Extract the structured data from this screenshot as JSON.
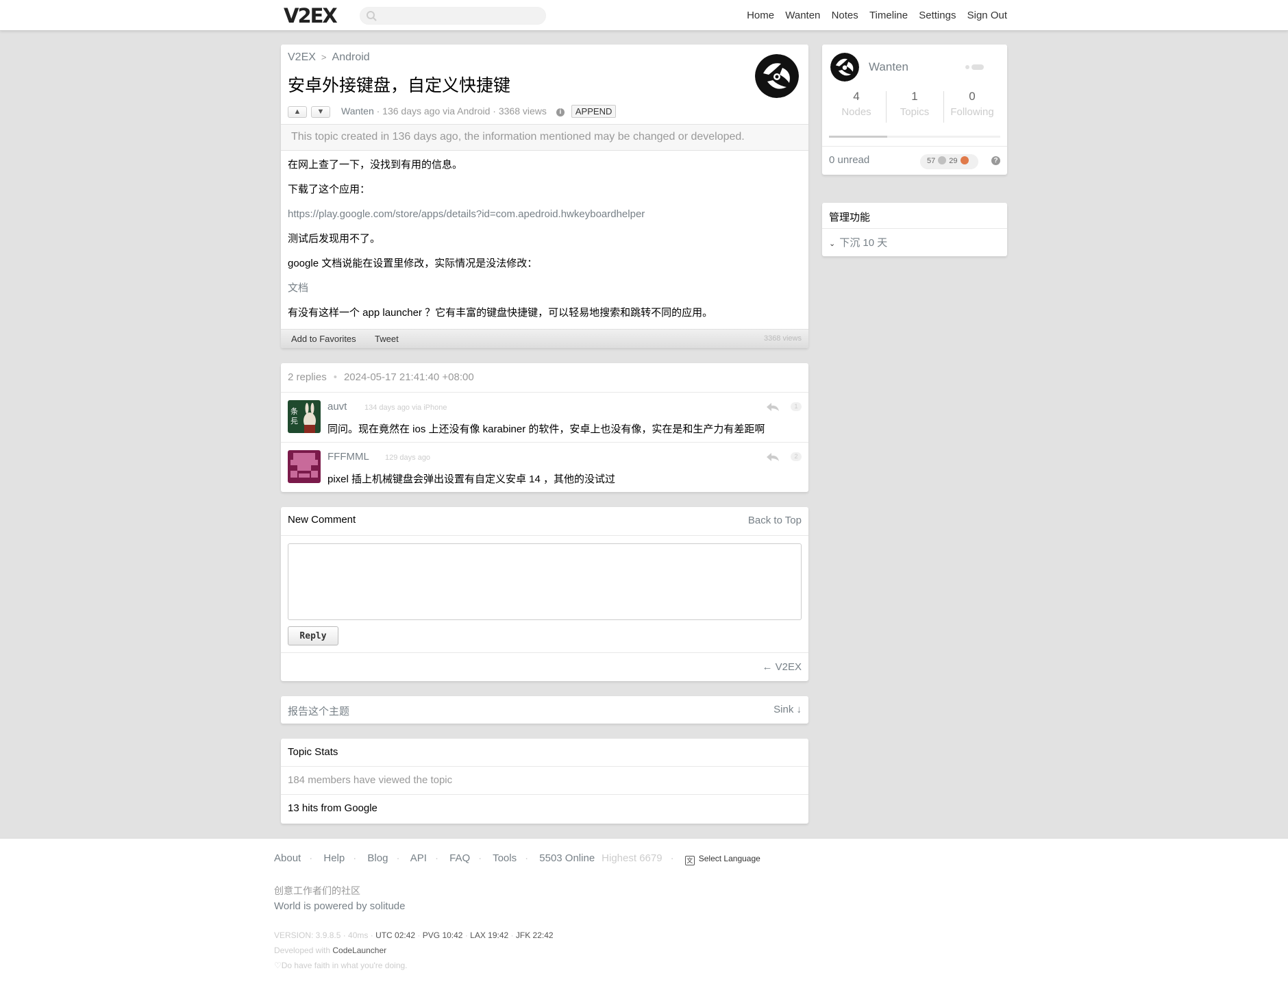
{
  "header": {
    "logo": "V2EX",
    "search_placeholder": "",
    "nav": [
      "Home",
      "Wanten",
      "Notes",
      "Timeline",
      "Settings",
      "Sign Out"
    ]
  },
  "topic": {
    "breadcrumb_root": "V2EX",
    "breadcrumb_sep": ">",
    "node": "Android",
    "title": "安卓外接键盘，自定义快捷键",
    "author": "Wanten",
    "meta": " · 136 days ago via Android · 3368 views",
    "append": "APPEND",
    "notice": "This topic created in 136 days ago, the information mentioned may be changed or developed.",
    "content": [
      "在网上查了一下，没找到有用的信息。",
      "下载了这个应用：",
      "https://play.google.com/store/apps/details?id=com.apedroid.hwkeyboardhelper",
      "测试后发现用不了。",
      "google 文档说能在设置里修改，实际情况是没法修改：",
      "文档",
      "有没有这样一个 app launcher ？它有丰富的键盘快捷键，可以轻易地搜索和跳转不同的应用。"
    ],
    "add_favorites": "Add to Favorites",
    "tweet": "Tweet",
    "views_small": "3368 views"
  },
  "replies": {
    "count": "2 replies",
    "dot": "•",
    "last_time": "2024-05-17 21:41:40 +08:00",
    "items": [
      {
        "name": "auvt",
        "time": "134 days ago via iPhone",
        "text": "同问。现在竟然在 ios 上还没有像 karabiner 的软件，安卓上也没有像，实在是和生产力有差距啊",
        "no": "1"
      },
      {
        "name": "FFFMML",
        "time": "129 days ago",
        "text": "pixel 插上机械键盘会弹出设置有自定义安卓 14 ，其他的没试过",
        "no": "2"
      }
    ]
  },
  "comment": {
    "title": "New Comment",
    "back_to_top": "Back to Top",
    "reply_btn": "Reply",
    "back_link": "← V2EX"
  },
  "report": {
    "label": "报告这个主题",
    "sink": "Sink ↓"
  },
  "stats": {
    "title": "Topic Stats",
    "viewed": "184 members have viewed the topic",
    "google": "13 hits from Google"
  },
  "sidebar": {
    "username": "Wanten",
    "counts": [
      {
        "n": "4",
        "label": "Nodes"
      },
      {
        "n": "1",
        "label": "Topics"
      },
      {
        "n": "0",
        "label": "Following"
      }
    ],
    "unread": "0 unread",
    "silver": "57",
    "bronze": "29",
    "progress": 0.34,
    "admin_title": "管理功能",
    "admin_item": "下沉 10 天"
  },
  "footer": {
    "links": [
      "About",
      "Help",
      "Blog",
      "API",
      "FAQ",
      "Tools"
    ],
    "online": "5503 Online",
    "highest": "Highest 6679",
    "language": "Select Language",
    "slogan_cn": "创意工作者们的社区",
    "slogan_en": "World is powered by solitude",
    "version": "VERSION: 3.9.8.5 · 40ms · ",
    "times": [
      "UTC 02:42",
      "PVG 10:42",
      "LAX 19:42",
      "JFK 22:42"
    ],
    "developed": "Developed with ",
    "codelauncher": "CodeLauncher",
    "faith": "♡Do have faith in what you're doing."
  },
  "colors": {
    "link": "#778087",
    "bg": "#e2e2e2",
    "silver": "#c0c0c0",
    "bronze": "#e07a4a"
  }
}
